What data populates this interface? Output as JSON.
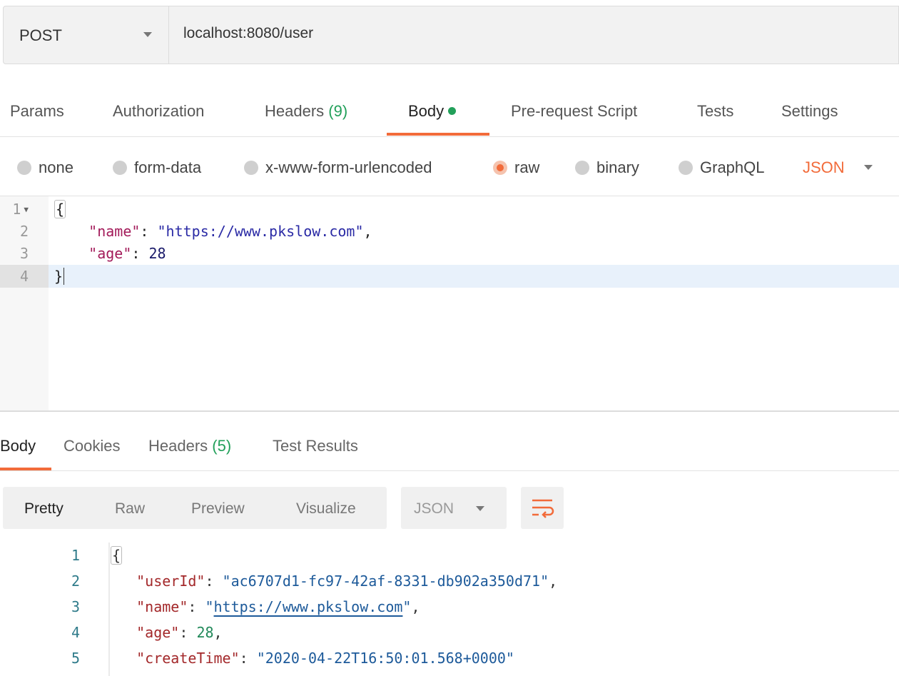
{
  "request": {
    "method": "POST",
    "url": "localhost:8080/user",
    "tabs": [
      {
        "label": "Params"
      },
      {
        "label": "Authorization"
      },
      {
        "label": "Headers",
        "count": "(9)"
      },
      {
        "label": "Body",
        "active": true
      },
      {
        "label": "Pre-request Script"
      },
      {
        "label": "Tests"
      },
      {
        "label": "Settings"
      }
    ],
    "body_types": [
      "none",
      "form-data",
      "x-www-form-urlencoded",
      "raw",
      "binary",
      "GraphQL"
    ],
    "selected_body_type": "raw",
    "language": "JSON",
    "editor_lines": [
      {
        "n": "1",
        "brace": "{"
      },
      {
        "n": "2",
        "key": "\"name\"",
        "sep": ": ",
        "value": "\"https://www.pkslow.com\"",
        "tail": ","
      },
      {
        "n": "3",
        "key": "\"age\"",
        "sep": ": ",
        "value": "28",
        "tail": ""
      },
      {
        "n": "4",
        "brace": "}"
      }
    ]
  },
  "response": {
    "tabs": [
      {
        "label": "Body",
        "active": true
      },
      {
        "label": "Cookies"
      },
      {
        "label": "Headers",
        "count": "(5)"
      },
      {
        "label": "Test Results"
      }
    ],
    "views": [
      "Pretty",
      "Raw",
      "Preview",
      "Visualize"
    ],
    "active_view": "Pretty",
    "format": "JSON",
    "lines": [
      {
        "n": "1",
        "text": "{"
      },
      {
        "n": "2",
        "key": "\"userId\"",
        "sep": ": ",
        "value": "\"ac6707d1-fc97-42af-8331-db902a350d71\"",
        "tail": ","
      },
      {
        "n": "3",
        "key": "\"name\"",
        "sep": ": ",
        "q1": "\"",
        "link": "https://www.pkslow.com",
        "q2": "\"",
        "tail": ","
      },
      {
        "n": "4",
        "key": "\"age\"",
        "sep": ": ",
        "value": "28",
        "tail": ","
      },
      {
        "n": "5",
        "key": "\"createTime\"",
        "sep": ": ",
        "value": "\"2020-04-22T16:50:01.568+0000\"",
        "tail": ""
      }
    ]
  },
  "colors": {
    "accent": "#f26b3a",
    "green": "#22a05a"
  }
}
